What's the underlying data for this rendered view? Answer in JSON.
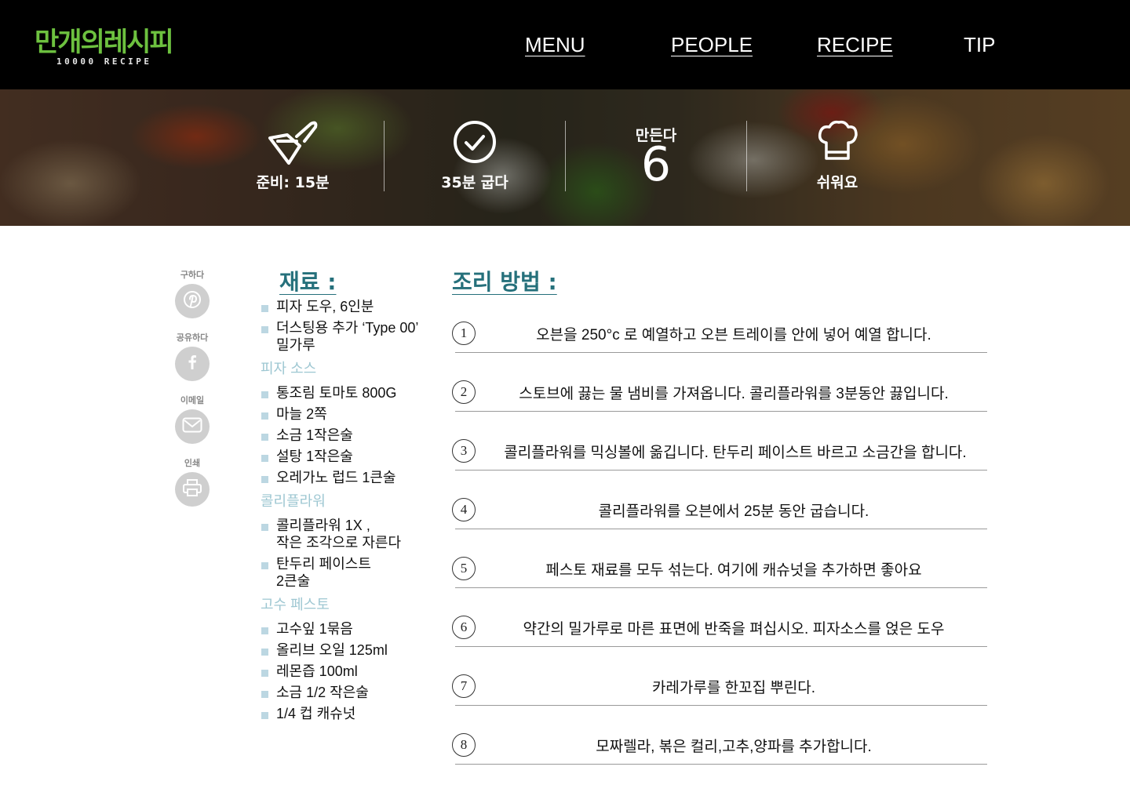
{
  "logo": {
    "main": "만개의레시피",
    "sub": "10000 RECIPE"
  },
  "nav": [
    {
      "label": "MENU"
    },
    {
      "label": "PEOPLE"
    },
    {
      "label": "RECIPE"
    },
    {
      "label": "TIP"
    }
  ],
  "stats": {
    "prep": {
      "label": "준비: 15분",
      "icon": "knife-board-icon"
    },
    "bake": {
      "label": "35분 굽다",
      "icon": "clock-icon"
    },
    "serves": {
      "label": "만든다",
      "value": "6"
    },
    "difficulty": {
      "label": "쉬워요",
      "icon": "chef-hat-icon"
    }
  },
  "share": {
    "pinterest_label": "구하다",
    "facebook_label": "공유하다",
    "email_label": "이메일",
    "print_label": "인쇄"
  },
  "ingredients": {
    "title": "재료 :",
    "base": [
      "피자 도우, 6인분",
      "더스팅용 추가 ‘Type 00’ 밀가루"
    ],
    "sauce_title": "피자 소스",
    "sauce": [
      "통조림 토마토 800G",
      "마늘 2쪽",
      "소금 1작은술",
      "설탕 1작은술",
      "오레가노 럽드 1큰술"
    ],
    "cauliflower_title": "콜리플라워",
    "cauliflower": [
      "콜리플라워 1X ,\n작은 조각으로 자른다",
      "탄두리 페이스트\n2큰술"
    ],
    "pesto_title": "고수 페스토",
    "pesto": [
      "고수잎 1묶음",
      "올리브 오일 125ml",
      "레몬즙 100ml",
      "소금 1/2 작은술",
      "1/4 컵 캐슈넛"
    ]
  },
  "steps": {
    "title": "조리 방법 :",
    "items": [
      {
        "num": "1",
        "text": "오븐을 250°c 로 예열하고 오븐 트레이를 안에 넣어 예열 합니다."
      },
      {
        "num": "2",
        "text": "스토브에 끓는 물 냄비를 가져옵니다. 콜리플라워를 3분동안 끓입니다."
      },
      {
        "num": "3",
        "text": "콜리플라워를 믹싱볼에 옮깁니다. 탄두리 페이스트 바르고 소금간을 합니다."
      },
      {
        "num": "4",
        "text": "콜리플라워를 오븐에서 25분 동안 굽습니다."
      },
      {
        "num": "5",
        "text": "페스토 재료를 모두 섞는다. 여기에 캐슈넛을 추가하면 좋아요"
      },
      {
        "num": "6",
        "text": "약간의 밀가루로 마른 표면에 반죽을 펴십시오. 피자소스를 얹은 도우"
      },
      {
        "num": "7",
        "text": "카레가루를 한꼬집 뿌린다."
      },
      {
        "num": "8",
        "text": "모짜렐라, 볶은 컬리,고추,양파를 추가합니다."
      }
    ]
  },
  "colors": {
    "accent": "#25707b",
    "section": "#9ec7d2",
    "logo": "#6dc13f",
    "bullet": "#bcd7e2"
  }
}
